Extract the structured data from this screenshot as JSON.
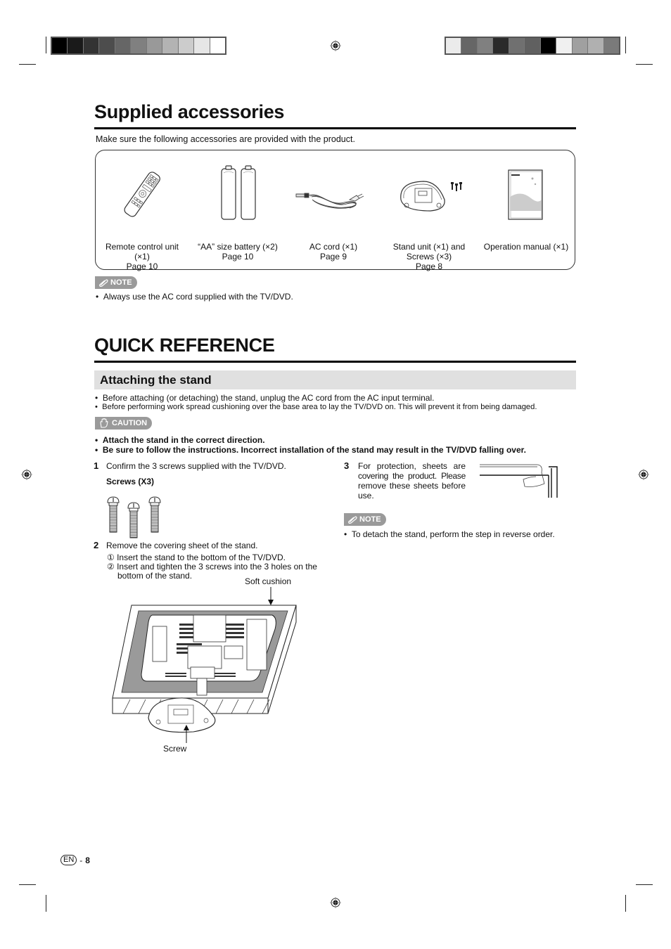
{
  "print_marks": {
    "left_bar_colors": [
      "#000000",
      "#1a1a1a",
      "#333333",
      "#4d4d4d",
      "#666666",
      "#808080",
      "#999999",
      "#b3b3b3",
      "#cccccc",
      "#e6e6e6",
      "#ffffff"
    ],
    "right_bar_colors": [
      "#ebebeb",
      "#666666",
      "#808080",
      "#2a2a2a",
      "#707070",
      "#606060",
      "#000000",
      "#f0f0f0",
      "#a0a0a0",
      "#b0b0b0",
      "#7a7a7a"
    ]
  },
  "supplied": {
    "title": "Supplied accessories",
    "intro": "Make sure the following accessories are provided with the product.",
    "items": [
      {
        "icon": "remote-control-icon",
        "lines": [
          "Remote control unit",
          "(×1)",
          "Page 10"
        ]
      },
      {
        "icon": "battery-icon",
        "lines": [
          "“AA” size battery (×2)",
          "Page 10"
        ]
      },
      {
        "icon": "ac-cord-icon",
        "lines": [
          "AC cord (×1)",
          "Page 9"
        ]
      },
      {
        "icon": "stand-unit-icon",
        "lines": [
          "Stand unit (×1) and",
          "Screws (×3)",
          "Page 8"
        ]
      },
      {
        "icon": "manual-icon",
        "lines": [
          "Operation manual (×1)"
        ]
      }
    ],
    "note_label": "NOTE",
    "note_bullets": [
      "Always use the AC cord supplied with the TV/DVD."
    ]
  },
  "quick_ref": {
    "title": "QUICK REFERENCE",
    "subheading": "Attaching the stand",
    "bullets": [
      "Before attaching (or detaching) the stand, unplug the AC cord from the AC input terminal.",
      "Before performing work spread cushioning over the base area to lay the TV/DVD on. This will prevent it from being damaged."
    ],
    "caution_label": "CAUTION",
    "caution_bullets": [
      "Attach the stand in the correct direction.",
      "Be sure to follow the instructions. Incorrect installation of the stand may result in the TV/DVD falling over."
    ],
    "steps": [
      {
        "num": "1",
        "text": "Confirm the 3 screws supplied with the TV/DVD.",
        "sub": "Screws (X3)"
      },
      {
        "num": "2",
        "text": "Remove the covering sheet of the stand.",
        "substeps": [
          "① Insert the stand to the bottom of the TV/DVD.",
          "② Insert and tighten the 3 screws into the 3 holes on the",
          "bottom of the stand."
        ]
      },
      {
        "num": "3",
        "text_lines": [
          "For protection, sheets are",
          "covering the product. Please",
          "remove these sheets before",
          "use."
        ]
      }
    ],
    "diagram_labels": {
      "cushion": "Soft cushion",
      "screw": "Screw"
    },
    "note_label": "NOTE",
    "note_bullets": [
      "To detach the stand, perform the step in reverse order."
    ]
  },
  "footer": {
    "lang": "EN",
    "sep": "-",
    "page": "8"
  }
}
